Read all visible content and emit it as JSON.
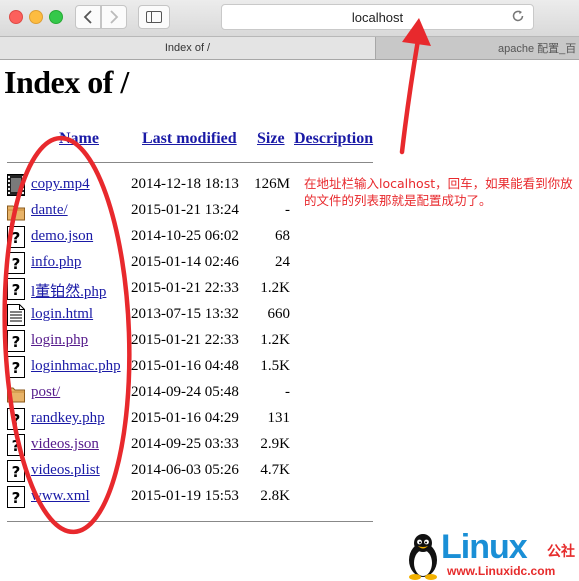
{
  "browser": {
    "address": "localhost",
    "tabs": [
      {
        "label": "Index of /"
      },
      {
        "label": "apache 配置_百"
      }
    ]
  },
  "page": {
    "heading": "Index of /",
    "columns": {
      "name": "Name",
      "modified": "Last modified",
      "size": "Size",
      "description": "Description"
    },
    "files": [
      {
        "name": "copy.mp4",
        "modified": "2014-12-18 18:13",
        "size": "126M",
        "icon": "movie-icon",
        "visited": false
      },
      {
        "name": "dante/",
        "modified": "2015-01-21 13:24",
        "size": "-",
        "icon": "folder-icon",
        "visited": false
      },
      {
        "name": "demo.json",
        "modified": "2014-10-25 06:02",
        "size": "68",
        "icon": "unknown-file-icon",
        "visited": false
      },
      {
        "name": "info.php",
        "modified": "2015-01-14 02:46",
        "size": "24",
        "icon": "unknown-file-icon",
        "visited": false
      },
      {
        "name": "l董铂然.php",
        "modified": "2015-01-21 22:33",
        "size": "1.2K",
        "icon": "unknown-file-icon",
        "visited": false
      },
      {
        "name": "login.html",
        "modified": "2013-07-15 13:32",
        "size": "660",
        "icon": "text-file-icon",
        "visited": false
      },
      {
        "name": "login.php",
        "modified": "2015-01-21 22:33",
        "size": "1.2K",
        "icon": "unknown-file-icon",
        "visited": true
      },
      {
        "name": "loginhmac.php",
        "modified": "2015-01-16 04:48",
        "size": "1.5K",
        "icon": "unknown-file-icon",
        "visited": false
      },
      {
        "name": "post/",
        "modified": "2014-09-24 05:48",
        "size": "-",
        "icon": "folder-icon",
        "visited": true
      },
      {
        "name": "randkey.php",
        "modified": "2015-01-16 04:29",
        "size": "131",
        "icon": "unknown-file-icon",
        "visited": false
      },
      {
        "name": "videos.json",
        "modified": "2014-09-25 03:33",
        "size": "2.9K",
        "icon": "unknown-file-icon",
        "visited": true
      },
      {
        "name": "videos.plist",
        "modified": "2014-06-03 05:26",
        "size": "4.7K",
        "icon": "unknown-file-icon",
        "visited": false
      },
      {
        "name": "www.xml",
        "modified": "2015-01-19 15:53",
        "size": "2.8K",
        "icon": "unknown-file-icon",
        "visited": false
      }
    ]
  },
  "annotation": {
    "note": "在地址栏输入localhost，回车，如果能看到你放的文件的列表那就是配置成功了。",
    "color": "#e8292d"
  },
  "watermark": {
    "brand": "Linux",
    "brand_cn": "公社",
    "url": "www.Linuxidc.com"
  },
  "colors": {
    "link": "#1a1aa6",
    "visited": "#551a8b"
  }
}
